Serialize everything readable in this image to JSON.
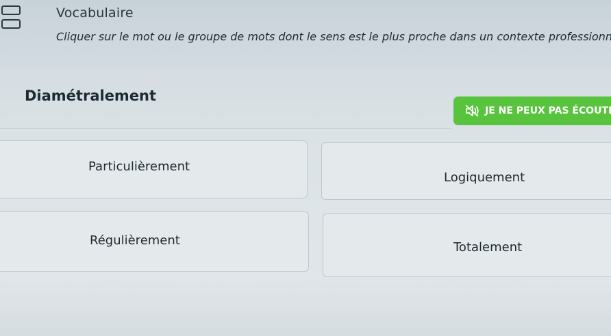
{
  "header": {
    "title": "Vocabulaire",
    "instruction": "Cliquer sur le mot ou le groupe de mots dont le sens est le plus proche dans un contexte professionnel."
  },
  "question": {
    "word": "Diamétralement",
    "listen_label": "JE NE PEUX PAS ÉCOUTER"
  },
  "options": [
    {
      "label": "Particulièrement"
    },
    {
      "label": "Logiquement"
    },
    {
      "label": "Régulièrement"
    },
    {
      "label": "Totalement"
    }
  ],
  "colors": {
    "listen_button": "#58c43e",
    "background": "#dbe2e6"
  },
  "icons": {
    "app": "grid-squares-icon",
    "listen": "speaker-muted-icon"
  }
}
